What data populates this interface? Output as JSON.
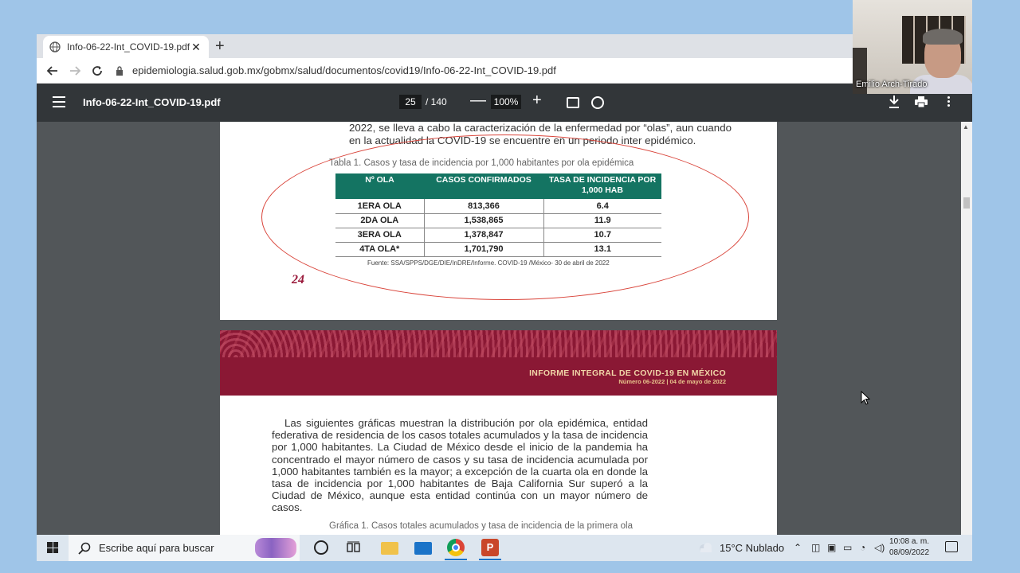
{
  "browser": {
    "tab_title": "Info-06-22-Int_COVID-19.pdf",
    "tab_close": "✕",
    "new_tab": "+",
    "url": "epidemiologia.salud.gob.mx/gobmx/salud/documentos/covid19/Info-06-22-Int_COVID-19.pdf"
  },
  "pdf_toolbar": {
    "title": "Info-06-22-Int_COVID-19.pdf",
    "current_page": "25",
    "total_pages": "/ 140",
    "zoom_minus": "—",
    "zoom": "100%",
    "zoom_plus": "+"
  },
  "page1": {
    "intro": "2022, se lleva a cabo la caracterización de la enfermedad por “olas”, aun cuando en la actualidad la COVID-19 se encuentre en un periodo inter epidémico.",
    "table_caption": "Tabla 1. Casos y tasa de incidencia por 1,000 habitantes por ola epidémica",
    "table": {
      "headers": [
        "Nº OLA",
        "CASOS CONFIRMADOS",
        "TASA DE INCIDENCIA POR 1,000 HAB"
      ],
      "rows": [
        [
          "1ERA OLA",
          "813,366",
          "6.4"
        ],
        [
          "2DA OLA",
          "1,538,865",
          "11.9"
        ],
        [
          "3ERA OLA",
          "1,378,847",
          "10.7"
        ],
        [
          "4TA OLA*",
          "1,701,790",
          "13.1"
        ]
      ]
    },
    "source": "Fuente: SSA/SPPS/DGE/DIE/InDRE/Informe. COVID-19 /México- 30 de abril de 2022",
    "page_number": "24"
  },
  "page2": {
    "banner_title": "INFORME INTEGRAL DE COVID-19 EN MÉXICO",
    "banner_sub": "Número 06-2022 | 04 de mayo de 2022",
    "body": "Las siguientes gráficas muestran la distribución por ola epidémica, entidad federativa de residencia de los casos totales acumulados y la tasa de incidencia por 1,000 habitantes. La Ciudad de México desde el inicio de la pandemia ha concentrado el mayor número de casos y su tasa de incidencia acumulada por 1,000 habitantes también es la mayor; a excepción de la cuarta ola en donde la tasa de incidencia por 1,000 habitantes de Baja California Sur superó a la Ciudad de México, aunque esta entidad continúa con un mayor número de casos.",
    "graph_caption": "Gráfica 1. Casos totales acumulados y tasa de incidencia de la primera ola"
  },
  "webcam": {
    "name": "Emilio Arch-Tirado"
  },
  "taskbar": {
    "search_placeholder": "Escribe aquí para buscar",
    "ppt_letter": "P",
    "weather": "15°C  Nublado",
    "time": "10:08 a. m.",
    "date": "08/09/2022"
  },
  "colors": {
    "table_header": "#147462",
    "banner": "#8a1834",
    "ellipse": "#d9443a",
    "pdf_toolbar": "#323639"
  }
}
